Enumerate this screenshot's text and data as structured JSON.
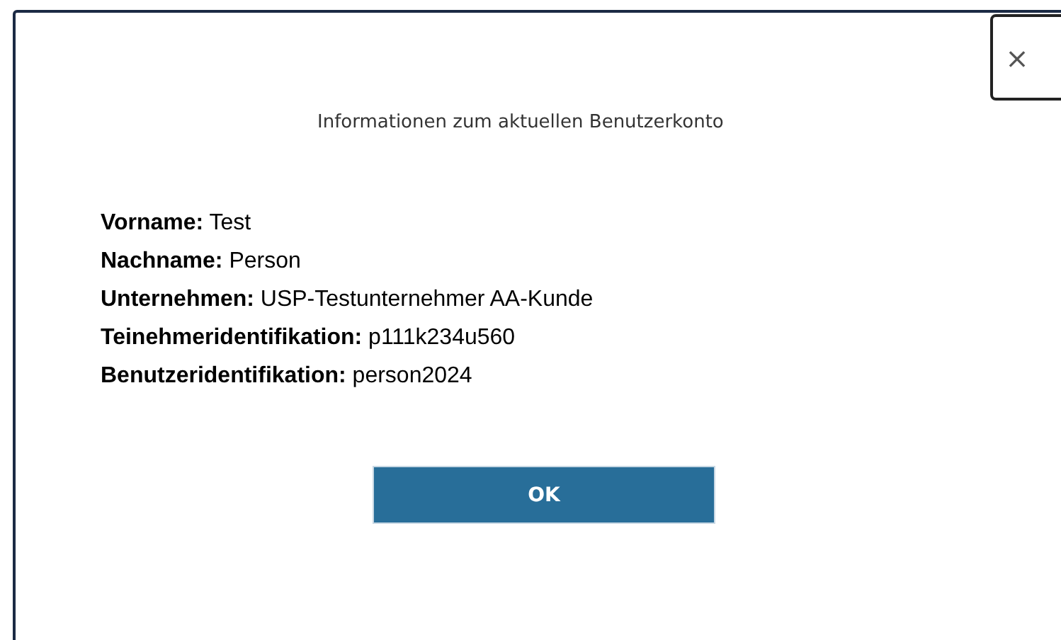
{
  "dialog": {
    "title": "Informationen zum aktuellen Benutzerkonto",
    "close": "×",
    "fields": [
      "**Vorname:** Test",
      "**Nachname:** Person",
      "**Unternehmen:** USP-Testunternehmer AA-Kunde",
      "**Teinehmeridentifikation:** p111k234u560",
      "**Benutzeridentifikation:** person2024"
    ],
    "button": "OK"
  }
}
